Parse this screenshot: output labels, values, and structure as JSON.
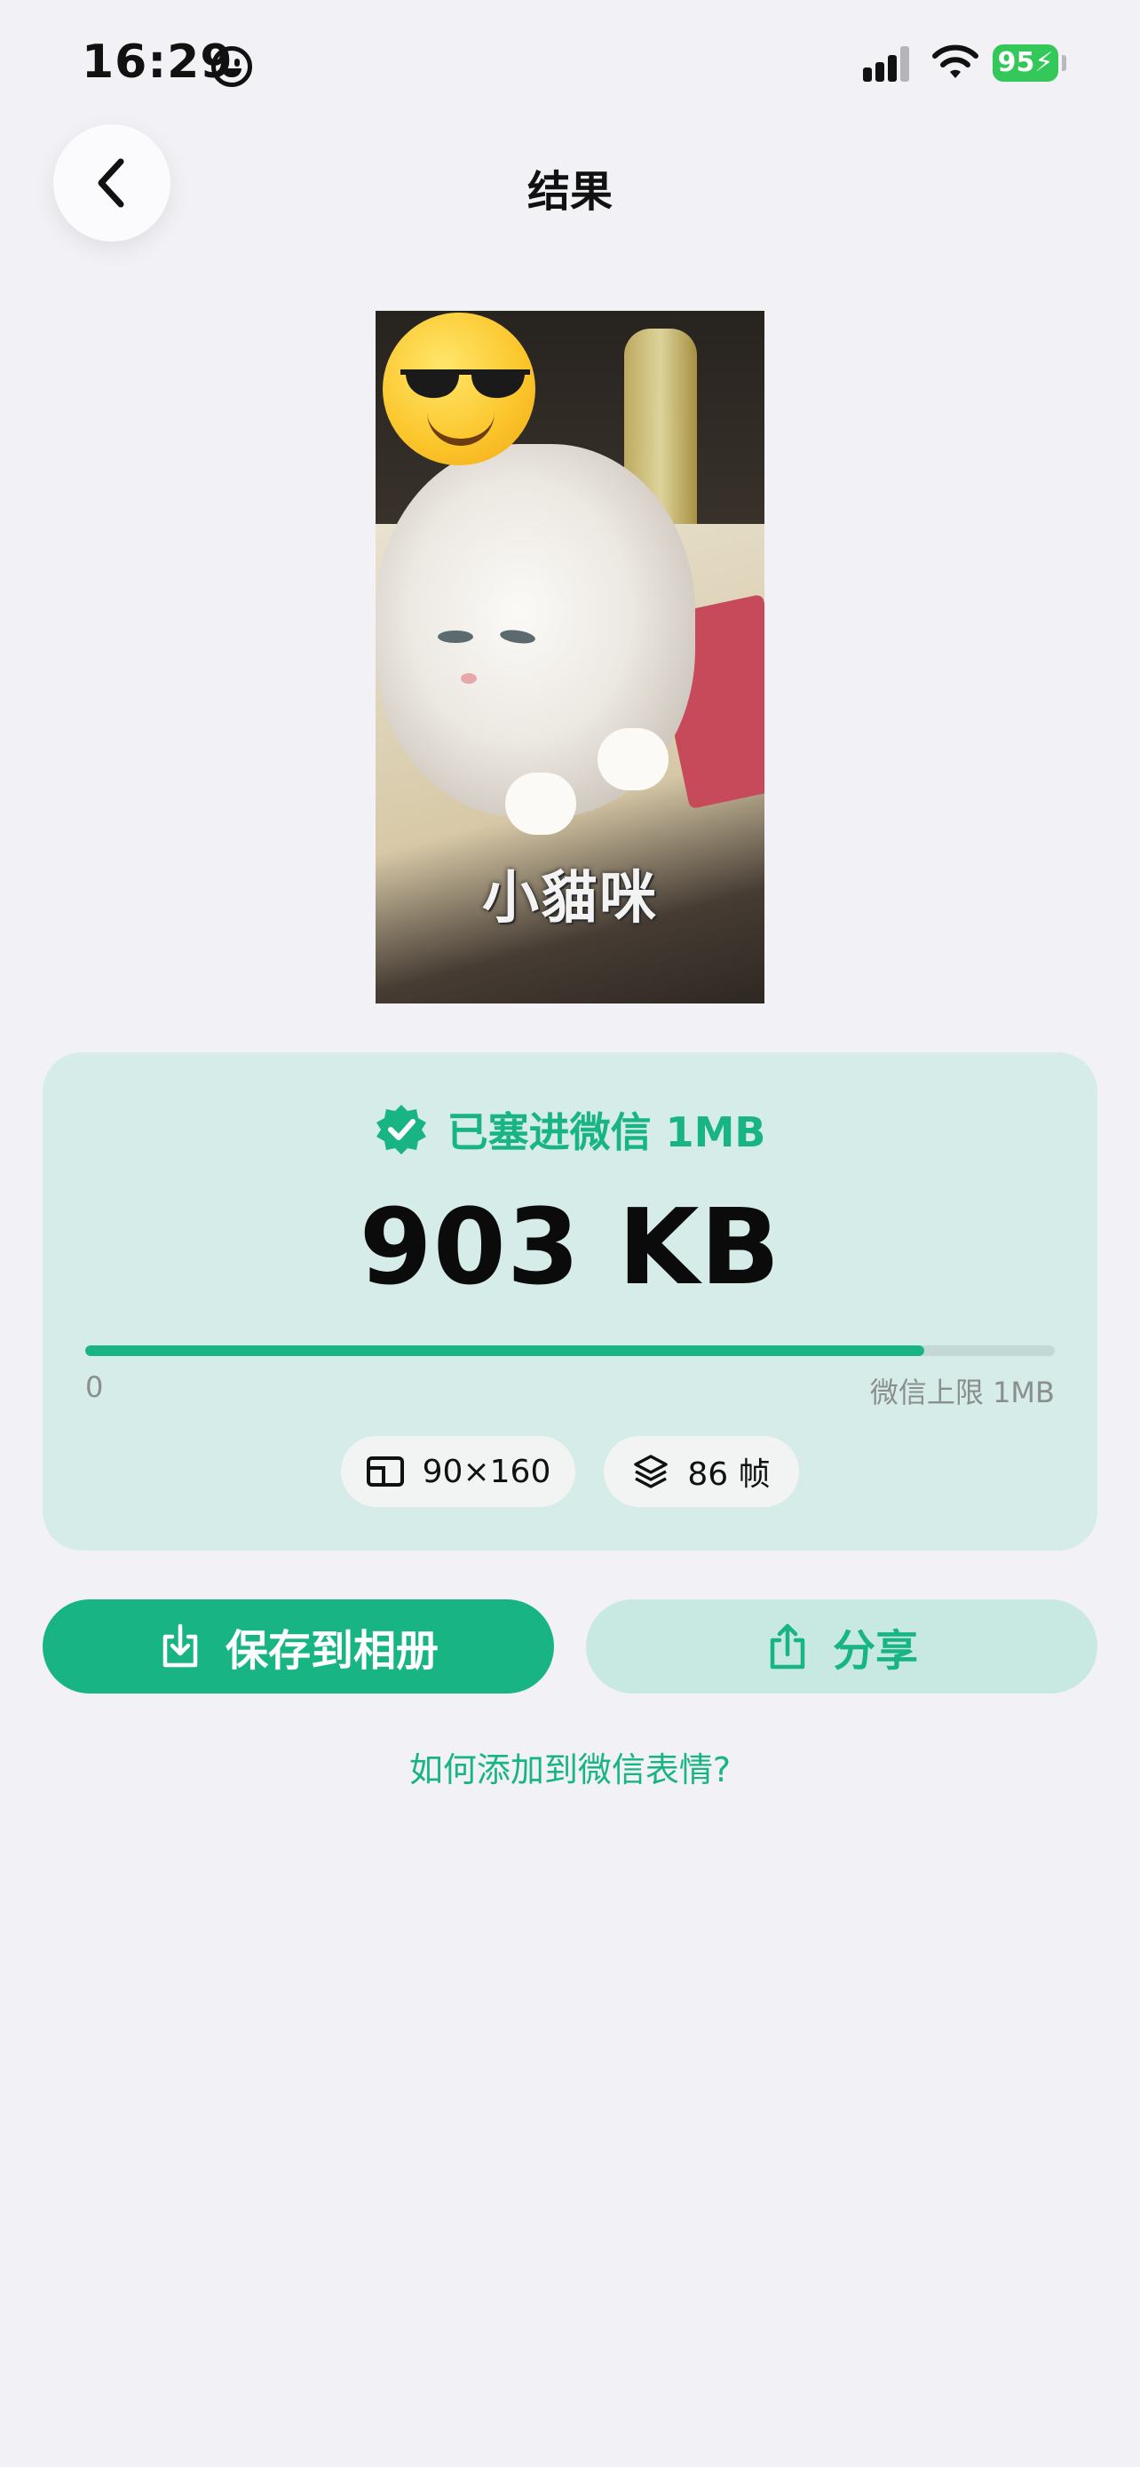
{
  "status_bar": {
    "time": "16:29",
    "battery": "95"
  },
  "header": {
    "title": "结果"
  },
  "preview": {
    "caption": "小貓咪"
  },
  "result": {
    "status_label": "已塞进微信 1MB",
    "size": "903 KB",
    "progress": 0.865,
    "scale_min": "0",
    "scale_max": "微信上限 1MB",
    "dimensions": "90×160",
    "frames": "86 帧"
  },
  "actions": {
    "save_label": "保存到相册",
    "share_label": "分享",
    "help_link": "如何添加到微信表情?"
  },
  "colors": {
    "accent": "#19b484",
    "card_bg": "#d6ece8",
    "page_bg": "#f2f2f6"
  }
}
